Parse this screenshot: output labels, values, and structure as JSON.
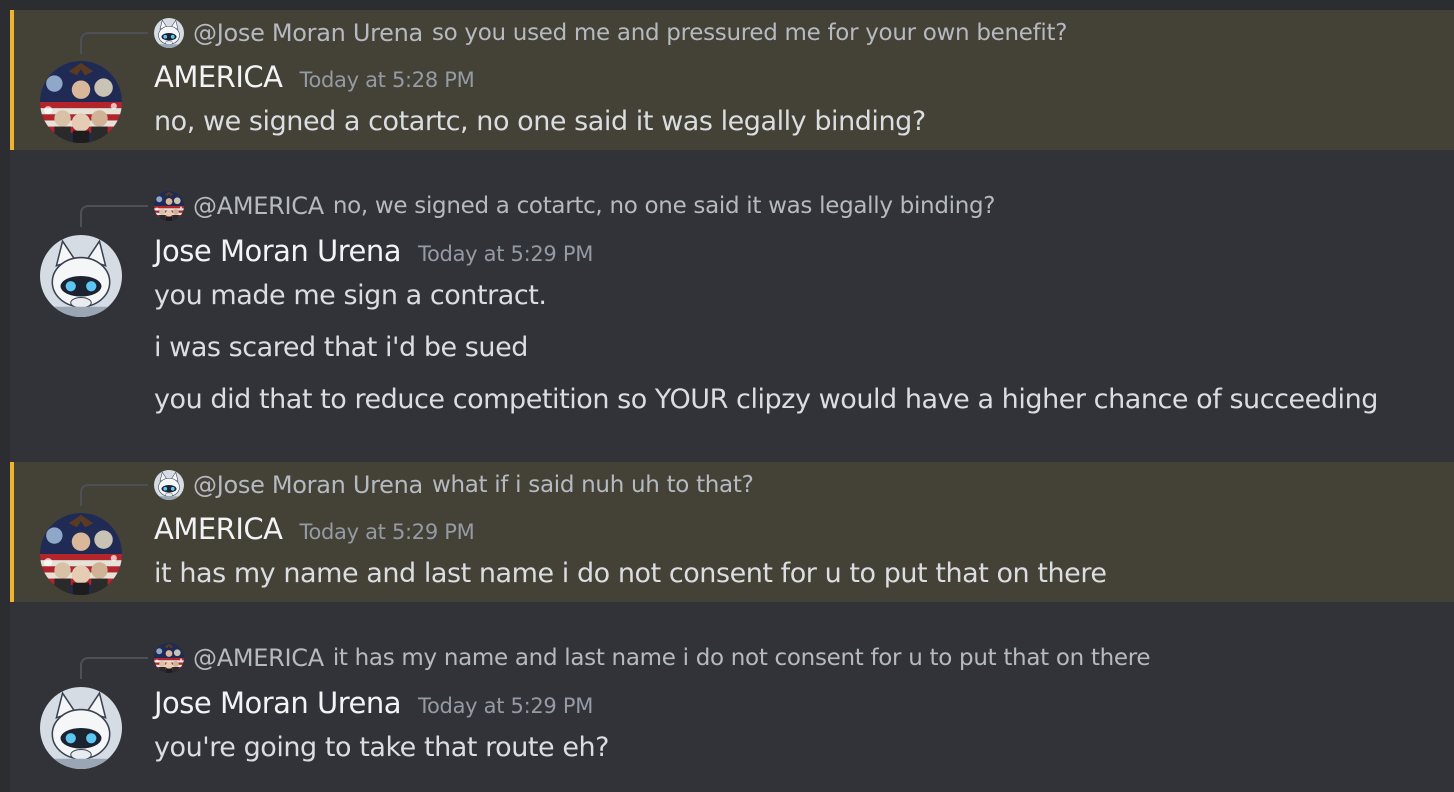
{
  "messages": [
    {
      "author": "AMERICA",
      "timestamp": "Today at 5:28 PM",
      "avatar_icon": "america-collage-avatar",
      "highlighted": true,
      "reply": {
        "author": "@Jose Moran Urena",
        "text": "so you used me and pressured me for your own benefit?"
      },
      "lines": [
        "no, we signed a cotartc, no one said it was legally binding?"
      ]
    },
    {
      "author": "Jose Moran Urena",
      "timestamp": "Today at 5:29 PM",
      "avatar_icon": "furry-character-avatar",
      "highlighted": false,
      "reply": {
        "author": "@AMERICA",
        "text": "no, we signed a cotartc, no one said it was legally binding?"
      },
      "lines": [
        "you made me sign a contract.",
        "i was scared that i'd be sued",
        "you did that to reduce competition so YOUR clipzy would have a higher chance of succeeding"
      ]
    },
    {
      "author": "AMERICA",
      "timestamp": "Today at 5:29 PM",
      "avatar_icon": "america-collage-avatar",
      "highlighted": true,
      "reply": {
        "author": "@Jose Moran Urena",
        "text": "what if i said nuh uh to that?"
      },
      "lines": [
        "it has my name and last name i do not consent for u to put that on there"
      ]
    },
    {
      "author": "Jose Moran Urena",
      "timestamp": "Today at 5:29 PM",
      "avatar_icon": "furry-character-avatar",
      "highlighted": false,
      "reply": {
        "author": "@AMERICA",
        "text": "it has my name and last name i do not consent for u to put that on there"
      },
      "lines": [
        "you're going to take that route eh?"
      ]
    }
  ],
  "colors": {
    "background": "#313338",
    "mention_highlight": "#444137",
    "mention_bar": "#f0b232",
    "username": "#f2f3f5",
    "message_text": "#dbdee1",
    "muted_text": "#b5bac1"
  }
}
